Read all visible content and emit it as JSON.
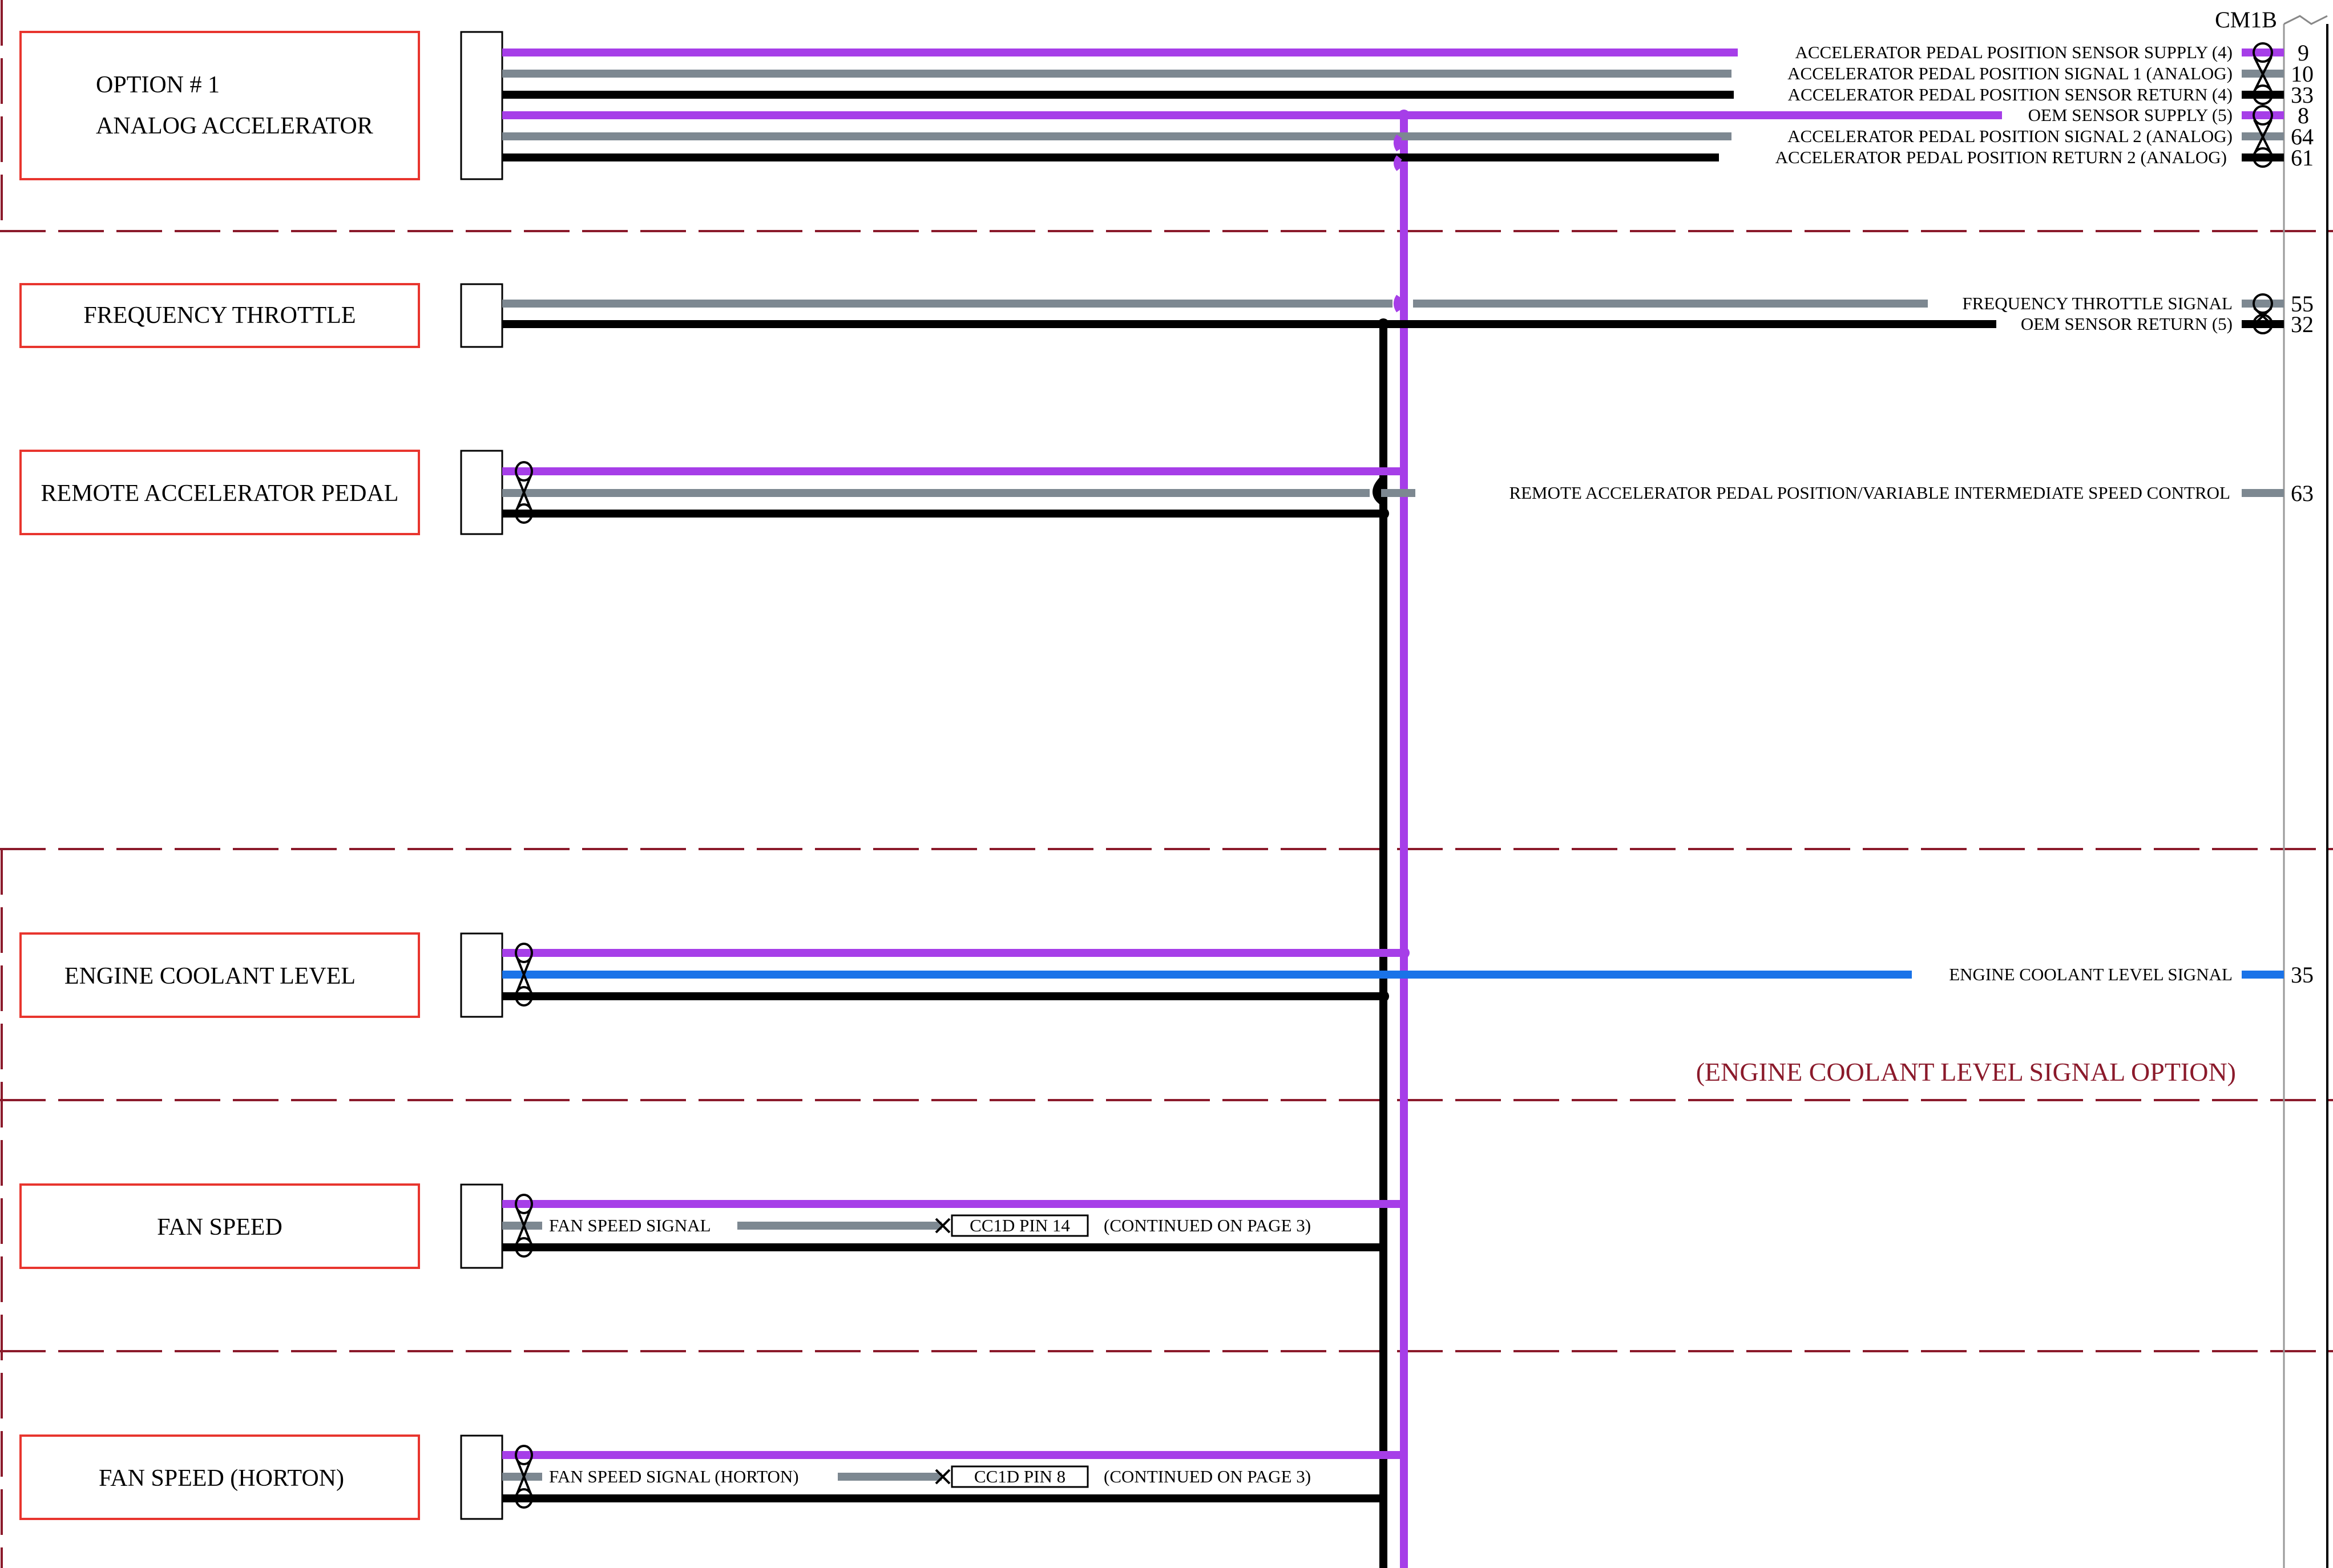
{
  "connector": {
    "name": "CM1B"
  },
  "components": {
    "analog_accelerator": {
      "line1": "OPTION # 1",
      "line2": "ANALOG ACCELERATOR"
    },
    "frequency_throttle": {
      "label": "FREQUENCY THROTTLE"
    },
    "remote_accelerator_pedal": {
      "label": "REMOTE ACCELERATOR PEDAL"
    },
    "engine_coolant_level": {
      "label": "ENGINE COOLANT LEVEL"
    },
    "fan_speed": {
      "label": "FAN SPEED"
    },
    "fan_speed_horton": {
      "label": "FAN SPEED (HORTON)"
    }
  },
  "circuits": [
    {
      "label": "ACCELERATOR PEDAL POSITION SENSOR SUPPLY (4)",
      "pin": "9",
      "color": "#a63ee8"
    },
    {
      "label": "ACCELERATOR PEDAL POSITION SIGNAL 1 (ANALOG)",
      "pin": "10",
      "color": "#7d8891"
    },
    {
      "label": "ACCELERATOR PEDAL POSITION SENSOR RETURN (4)",
      "pin": "33",
      "color": "#000000"
    },
    {
      "label": "OEM SENSOR SUPPLY (5)",
      "pin": "8",
      "color": "#a63ee8"
    },
    {
      "label": "ACCELERATOR PEDAL POSITION SIGNAL 2 (ANALOG)",
      "pin": "64",
      "color": "#7d8891"
    },
    {
      "label": "ACCELERATOR PEDAL POSITION RETURN 2 (ANALOG)",
      "pin": "61",
      "color": "#000000"
    },
    {
      "label": "FREQUENCY THROTTLE SIGNAL",
      "pin": "55",
      "color": "#7d8891"
    },
    {
      "label": "OEM SENSOR RETURN (5)",
      "pin": "32",
      "color": "#000000"
    },
    {
      "label": "REMOTE ACCELERATOR PEDAL POSITION/VARIABLE INTERMEDIATE SPEED CONTROL",
      "pin": "63",
      "color": "#7d8891"
    },
    {
      "label": "ENGINE COOLANT LEVEL SIGNAL",
      "pin": "35",
      "color": "#1a73e8"
    }
  ],
  "option_note": "(ENGINE COOLANT LEVEL SIGNAL OPTION)",
  "fan_speed": {
    "signal_label": "FAN SPEED SIGNAL",
    "ref": "CC1D PIN 14",
    "continued": "(CONTINUED ON PAGE 3)"
  },
  "fan_speed_horton": {
    "signal_label": "FAN SPEED SIGNAL (HORTON)",
    "ref": "CC1D PIN 8",
    "continued": "(CONTINUED ON PAGE 3)"
  },
  "wire_colors": {
    "supply": "#a63ee8",
    "signal": "#7d8891",
    "return": "#000000",
    "coolant": "#1a73e8",
    "component_border": "#e8352e",
    "section_divider": "#8b1a2b"
  }
}
